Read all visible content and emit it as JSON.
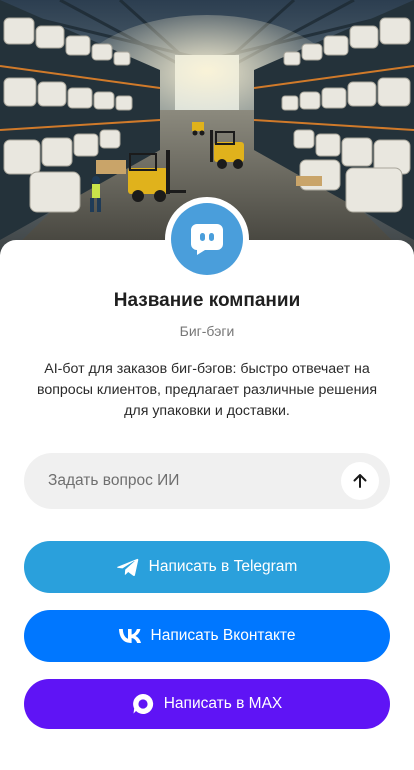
{
  "company": {
    "name": "Название компании",
    "subtitle": "Биг-бэги",
    "description": "AI-бот для заказов биг-бэгов: быстро отвечает на вопросы клиентов, предлагает различные решения для упаковки и доставки."
  },
  "hero": {
    "icon": "warehouse-photo",
    "alt": ""
  },
  "avatar": {
    "icon": "chat-bot-icon",
    "color": "#4a9edb"
  },
  "ask": {
    "placeholder": "Задать вопрос ИИ",
    "value": "",
    "send_icon": "arrow-up-icon"
  },
  "buttons": {
    "telegram": {
      "label": "Написать в Telegram",
      "icon": "telegram-icon",
      "color": "#2aa0dc"
    },
    "vk": {
      "label": "Написать Вконтакте",
      "icon": "vk-icon",
      "color": "#0077ff"
    },
    "max": {
      "label": "Написать в MAX",
      "icon": "max-icon",
      "color": "#5f14f5"
    }
  }
}
